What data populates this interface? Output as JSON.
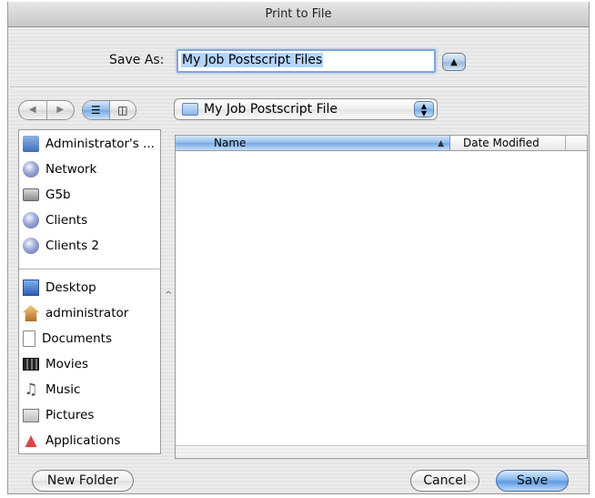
{
  "window": {
    "title": "Print to File"
  },
  "save_as": {
    "label": "Save As:",
    "value": "My Job Postscript Files",
    "expand_button_icon": "triangle-up-icon"
  },
  "navigation": {
    "back_icon": "back-arrow-icon",
    "forward_icon": "forward-arrow-icon",
    "list_view_icon": "list-view-icon",
    "column_view_icon": "column-view-icon"
  },
  "location": {
    "label": "My Job Postscript File",
    "folder_icon": "folder-icon"
  },
  "sidebar": {
    "devices": [
      {
        "label": "Administrator's ...",
        "icon": "computer-icon"
      },
      {
        "label": "Network",
        "icon": "globe-icon"
      },
      {
        "label": "G5b",
        "icon": "hard-disk-icon"
      },
      {
        "label": "Clients",
        "icon": "server-icon"
      },
      {
        "label": "Clients 2",
        "icon": "server-icon"
      }
    ],
    "places": [
      {
        "label": "Desktop",
        "icon": "desktop-icon"
      },
      {
        "label": "administrator",
        "icon": "home-icon"
      },
      {
        "label": "Documents",
        "icon": "documents-icon"
      },
      {
        "label": "Movies",
        "icon": "movies-icon"
      },
      {
        "label": "Music",
        "icon": "music-icon"
      },
      {
        "label": "Pictures",
        "icon": "pictures-icon"
      },
      {
        "label": "Applications",
        "icon": "applications-icon"
      }
    ]
  },
  "file_list": {
    "columns": [
      "Name",
      "Date Modified"
    ],
    "sort_column": "Name",
    "rows": []
  },
  "buttons": {
    "new_folder": "New Folder",
    "cancel": "Cancel",
    "save": "Save"
  },
  "colors": {
    "accent": "#7fa7d9",
    "selection": "#b5d4fd",
    "header_active": "#8fbbea"
  }
}
